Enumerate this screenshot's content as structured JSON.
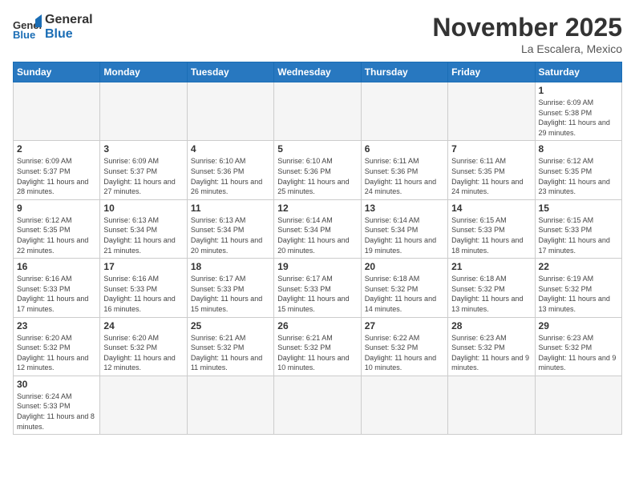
{
  "header": {
    "logo": {
      "text_general": "General",
      "text_blue": "Blue"
    },
    "title": "November 2025",
    "location": "La Escalera, Mexico"
  },
  "days_of_week": [
    "Sunday",
    "Monday",
    "Tuesday",
    "Wednesday",
    "Thursday",
    "Friday",
    "Saturday"
  ],
  "weeks": [
    [
      {
        "day": "",
        "empty": true
      },
      {
        "day": "",
        "empty": true
      },
      {
        "day": "",
        "empty": true
      },
      {
        "day": "",
        "empty": true
      },
      {
        "day": "",
        "empty": true
      },
      {
        "day": "",
        "empty": true
      },
      {
        "day": "1",
        "sunrise": "6:09 AM",
        "sunset": "5:38 PM",
        "daylight": "11 hours and 29 minutes."
      }
    ],
    [
      {
        "day": "2",
        "sunrise": "6:09 AM",
        "sunset": "5:37 PM",
        "daylight": "11 hours and 28 minutes."
      },
      {
        "day": "3",
        "sunrise": "6:09 AM",
        "sunset": "5:37 PM",
        "daylight": "11 hours and 27 minutes."
      },
      {
        "day": "4",
        "sunrise": "6:10 AM",
        "sunset": "5:36 PM",
        "daylight": "11 hours and 26 minutes."
      },
      {
        "day": "5",
        "sunrise": "6:10 AM",
        "sunset": "5:36 PM",
        "daylight": "11 hours and 25 minutes."
      },
      {
        "day": "6",
        "sunrise": "6:11 AM",
        "sunset": "5:36 PM",
        "daylight": "11 hours and 24 minutes."
      },
      {
        "day": "7",
        "sunrise": "6:11 AM",
        "sunset": "5:35 PM",
        "daylight": "11 hours and 24 minutes."
      },
      {
        "day": "8",
        "sunrise": "6:12 AM",
        "sunset": "5:35 PM",
        "daylight": "11 hours and 23 minutes."
      }
    ],
    [
      {
        "day": "9",
        "sunrise": "6:12 AM",
        "sunset": "5:35 PM",
        "daylight": "11 hours and 22 minutes."
      },
      {
        "day": "10",
        "sunrise": "6:13 AM",
        "sunset": "5:34 PM",
        "daylight": "11 hours and 21 minutes."
      },
      {
        "day": "11",
        "sunrise": "6:13 AM",
        "sunset": "5:34 PM",
        "daylight": "11 hours and 20 minutes."
      },
      {
        "day": "12",
        "sunrise": "6:14 AM",
        "sunset": "5:34 PM",
        "daylight": "11 hours and 20 minutes."
      },
      {
        "day": "13",
        "sunrise": "6:14 AM",
        "sunset": "5:34 PM",
        "daylight": "11 hours and 19 minutes."
      },
      {
        "day": "14",
        "sunrise": "6:15 AM",
        "sunset": "5:33 PM",
        "daylight": "11 hours and 18 minutes."
      },
      {
        "day": "15",
        "sunrise": "6:15 AM",
        "sunset": "5:33 PM",
        "daylight": "11 hours and 17 minutes."
      }
    ],
    [
      {
        "day": "16",
        "sunrise": "6:16 AM",
        "sunset": "5:33 PM",
        "daylight": "11 hours and 17 minutes."
      },
      {
        "day": "17",
        "sunrise": "6:16 AM",
        "sunset": "5:33 PM",
        "daylight": "11 hours and 16 minutes."
      },
      {
        "day": "18",
        "sunrise": "6:17 AM",
        "sunset": "5:33 PM",
        "daylight": "11 hours and 15 minutes."
      },
      {
        "day": "19",
        "sunrise": "6:17 AM",
        "sunset": "5:33 PM",
        "daylight": "11 hours and 15 minutes."
      },
      {
        "day": "20",
        "sunrise": "6:18 AM",
        "sunset": "5:32 PM",
        "daylight": "11 hours and 14 minutes."
      },
      {
        "day": "21",
        "sunrise": "6:18 AM",
        "sunset": "5:32 PM",
        "daylight": "11 hours and 13 minutes."
      },
      {
        "day": "22",
        "sunrise": "6:19 AM",
        "sunset": "5:32 PM",
        "daylight": "11 hours and 13 minutes."
      }
    ],
    [
      {
        "day": "23",
        "sunrise": "6:20 AM",
        "sunset": "5:32 PM",
        "daylight": "11 hours and 12 minutes."
      },
      {
        "day": "24",
        "sunrise": "6:20 AM",
        "sunset": "5:32 PM",
        "daylight": "11 hours and 12 minutes."
      },
      {
        "day": "25",
        "sunrise": "6:21 AM",
        "sunset": "5:32 PM",
        "daylight": "11 hours and 11 minutes."
      },
      {
        "day": "26",
        "sunrise": "6:21 AM",
        "sunset": "5:32 PM",
        "daylight": "11 hours and 10 minutes."
      },
      {
        "day": "27",
        "sunrise": "6:22 AM",
        "sunset": "5:32 PM",
        "daylight": "11 hours and 10 minutes."
      },
      {
        "day": "28",
        "sunrise": "6:23 AM",
        "sunset": "5:32 PM",
        "daylight": "11 hours and 9 minutes."
      },
      {
        "day": "29",
        "sunrise": "6:23 AM",
        "sunset": "5:32 PM",
        "daylight": "11 hours and 9 minutes."
      }
    ],
    [
      {
        "day": "30",
        "sunrise": "6:24 AM",
        "sunset": "5:33 PM",
        "daylight": "11 hours and 8 minutes."
      },
      {
        "day": "",
        "empty": true
      },
      {
        "day": "",
        "empty": true
      },
      {
        "day": "",
        "empty": true
      },
      {
        "day": "",
        "empty": true
      },
      {
        "day": "",
        "empty": true
      },
      {
        "day": "",
        "empty": true
      }
    ]
  ],
  "labels": {
    "sunrise": "Sunrise:",
    "sunset": "Sunset:",
    "daylight": "Daylight:"
  }
}
